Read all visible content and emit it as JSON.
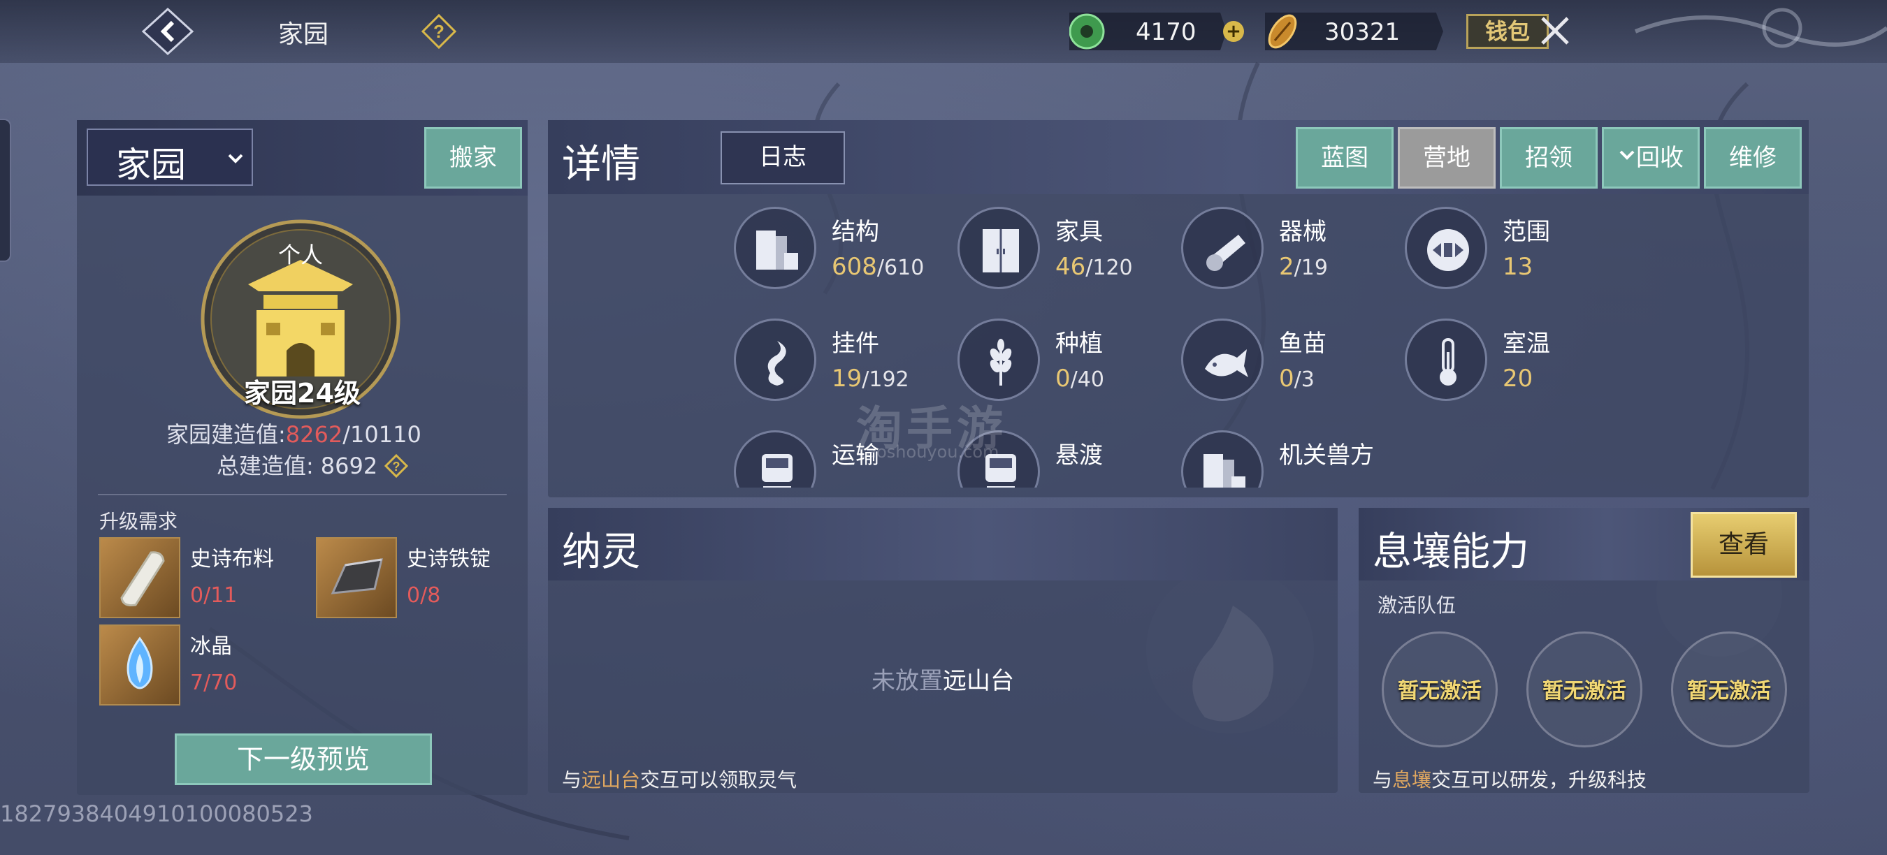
{
  "header": {
    "title": "家园",
    "jade": "4170",
    "coin": "30321",
    "wallet_label": "钱包"
  },
  "left_panel": {
    "select_value": "家园",
    "move_label": "搬家",
    "emblem_top_text": "个人",
    "level_label": "家园24级",
    "build_label": "家园建造值:",
    "build_current": "8262",
    "build_max": "/10110",
    "total_label": "总建造值:",
    "total_value": "8692",
    "req_title": "升级需求",
    "items": [
      {
        "name": "史诗布料",
        "count": "0/11"
      },
      {
        "name": "史诗铁锭",
        "count": "0/8"
      },
      {
        "name": "冰晶",
        "count": "7/70"
      }
    ],
    "next_label": "下一级预览",
    "uid": "1827938404910100080523"
  },
  "details": {
    "title": "详情",
    "log_label": "日志",
    "buttons": [
      "蓝图",
      "营地",
      "招领",
      "回收",
      "维修"
    ],
    "stats": [
      {
        "label": "结构",
        "value": "608",
        "max": "/610"
      },
      {
        "label": "家具",
        "value": "46",
        "max": "/120"
      },
      {
        "label": "器械",
        "value": "2",
        "max": "/19"
      },
      {
        "label": "范围",
        "value": "13",
        "max": ""
      },
      {
        "label": "挂件",
        "value": "19",
        "max": "/192"
      },
      {
        "label": "种植",
        "value": "0",
        "max": "/40"
      },
      {
        "label": "鱼苗",
        "value": "0",
        "max": "/3"
      },
      {
        "label": "室温",
        "value": "20",
        "max": ""
      },
      {
        "label": "运输",
        "value": "",
        "max": ""
      },
      {
        "label": "悬渡",
        "value": "",
        "max": ""
      },
      {
        "label": "机关兽方",
        "value": "",
        "max": ""
      }
    ],
    "watermark": "淘手游",
    "watermark_sub": "taoshouyou.com"
  },
  "spirit": {
    "title": "纳灵",
    "empty_prefix": "未放置",
    "empty_target": "远山台",
    "foot_prefix": "与",
    "foot_link": "远山台",
    "foot_suffix": "交互可以领取灵气"
  },
  "ability": {
    "title": "息壤能力",
    "view_label": "查看",
    "team_label": "激活队伍",
    "slots": [
      "暂无激活",
      "暂无激活",
      "暂无激活"
    ],
    "foot_prefix": "与",
    "foot_link": "息壤",
    "foot_suffix": "交互可以研发，升级科技"
  },
  "colors": {
    "teal": "#6aa79b",
    "gold": "#e8c773",
    "red": "#e35b5b",
    "orange": "#e1a860"
  }
}
